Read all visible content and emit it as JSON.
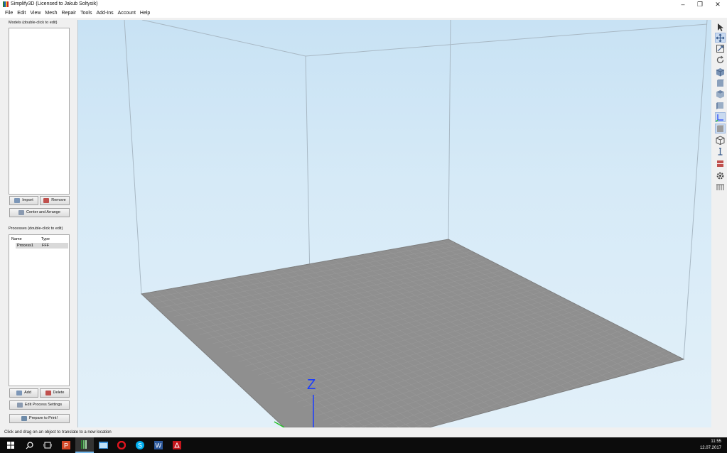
{
  "window": {
    "title": "Simplify3D (Licensed to Jakub Soltysik)",
    "minimize_glyph": "–",
    "restore_glyph": "❐",
    "close_glyph": "✕"
  },
  "menu": [
    "File",
    "Edit",
    "View",
    "Mesh",
    "Repair",
    "Tools",
    "Add-Ins",
    "Account",
    "Help"
  ],
  "models": {
    "label": "Models (double-click to edit)",
    "import_label": "Import",
    "remove_label": "Remove",
    "center_arrange_label": "Center and Arrange"
  },
  "processes": {
    "label": "Processes (double-click to edit)",
    "columns": [
      "Name",
      "Type"
    ],
    "rows": [
      {
        "name": "Process1",
        "type": "FFF"
      }
    ],
    "add_label": "Add",
    "delete_label": "Delete",
    "edit_settings_label": "Edit Process Settings",
    "prepare_label": "Prepare to Print!"
  },
  "viewport": {
    "axis_label": "Z"
  },
  "right_toolbar": [
    {
      "icon": "select-arrow-icon",
      "active": false
    },
    {
      "icon": "move-translate-icon",
      "active": true
    },
    {
      "icon": "scale-icon",
      "active": false
    },
    {
      "icon": "rotate-icon",
      "active": false
    },
    {
      "icon": "view-iso-icon",
      "active": false
    },
    {
      "icon": "view-front-icon",
      "active": false
    },
    {
      "icon": "view-top-icon",
      "active": false
    },
    {
      "icon": "view-side-icon",
      "active": false
    },
    {
      "icon": "axes-icon",
      "active": true
    },
    {
      "icon": "build-volume-icon",
      "active": true
    },
    {
      "icon": "wireframe-icon",
      "active": false
    },
    {
      "icon": "ruler-icon",
      "active": false
    },
    {
      "icon": "cross-section-icon",
      "active": false
    },
    {
      "icon": "settings-gear-icon",
      "active": false
    },
    {
      "icon": "support-icon",
      "active": false
    }
  ],
  "status": {
    "text": "Click and drag on an object to translate to a new location"
  },
  "taskbar": {
    "time": "11:55",
    "date": "12.07.2017",
    "apps": [
      "start-icon",
      "search-icon",
      "task-view-icon",
      "powerpoint-icon",
      "simplify3d-icon",
      "explorer-icon",
      "opera-icon",
      "skype-icon",
      "word-icon",
      "acrobat-icon"
    ]
  },
  "colors": {
    "bed": "#8f8f8f",
    "bed_grid": "#9b9b9b",
    "frame": "#a8b8c4",
    "z_axis": "#1a3cff",
    "y_axis": "#22c022"
  }
}
